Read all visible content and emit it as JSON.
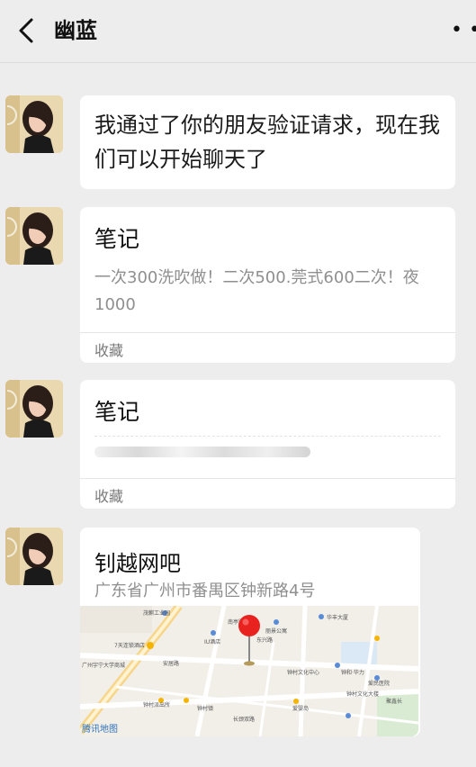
{
  "header": {
    "title": "幽蓝",
    "more_label": "• •"
  },
  "messages": [
    {
      "type": "text",
      "text": "我通过了你的朋友验证请求，现在我们可以开始聊天了"
    },
    {
      "type": "note",
      "title": "笔记",
      "body": "一次300洗吹做！二次500.莞式600二次！夜1000",
      "footer": "收藏"
    },
    {
      "type": "note",
      "title": "笔记",
      "footer": "收藏"
    },
    {
      "type": "location",
      "name": "钊越网吧",
      "address": "广东省广州市番禺区钟新路4号",
      "map_provider": "腾讯地图",
      "map_labels": [
        "茂麒工业园",
        "丽景公寓",
        "华丰大厦",
        "南亭路",
        "东兴路",
        "IU酒店",
        "7天连锁酒店",
        "安居路",
        "侨丽湾公寓",
        "金业北路",
        "钟村中学",
        "广州宇宁大学商城",
        "钟村派出所",
        "钟村镇",
        "钟村区区区",
        "钟村文化中心",
        "钟村文化大楼",
        "长颈双路",
        "爱婴岛",
        "文化路",
        "市文化路",
        "钟和·华力",
        "爱民医院",
        "聚鑫长"
      ]
    }
  ],
  "colors": {
    "background": "#ededed",
    "bubble": "#ffffff",
    "pin": "#e8231f"
  }
}
